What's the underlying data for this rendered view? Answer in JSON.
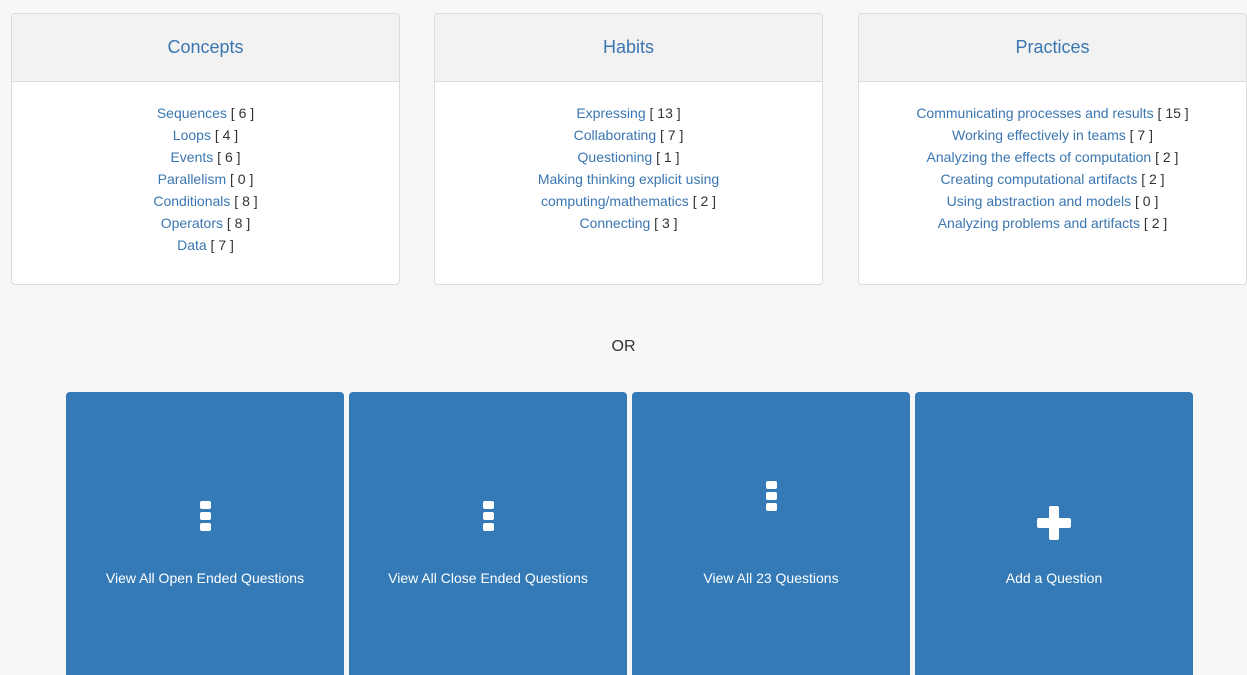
{
  "panels": [
    {
      "title": "Concepts",
      "items": [
        {
          "label": "Sequences",
          "count": "[ 6 ]"
        },
        {
          "label": "Loops",
          "count": "[ 4 ]"
        },
        {
          "label": "Events",
          "count": "[ 6 ]"
        },
        {
          "label": "Parallelism",
          "count": "[ 0 ]"
        },
        {
          "label": "Conditionals",
          "count": "[ 8 ]"
        },
        {
          "label": "Operators",
          "count": "[ 8 ]"
        },
        {
          "label": "Data",
          "count": "[ 7 ]"
        }
      ]
    },
    {
      "title": "Habits",
      "items": [
        {
          "label": "Expressing",
          "count": "[ 13 ]"
        },
        {
          "label": "Collaborating",
          "count": "[ 7 ]"
        },
        {
          "label": "Questioning",
          "count": "[ 1 ]"
        },
        {
          "label_line1": "Making thinking explicit using",
          "label": "computing/mathematics",
          "count": "[ 2 ]"
        },
        {
          "label": "Connecting",
          "count": "[ 3 ]"
        }
      ]
    },
    {
      "title": "Practices",
      "items": [
        {
          "label": "Communicating processes and results",
          "count": "[ 15 ]"
        },
        {
          "label": "Working effectively in teams",
          "count": "[ 7 ]"
        },
        {
          "label": "Analyzing the effects of computation",
          "count": "[ 2 ]"
        },
        {
          "label": "Creating computational artifacts",
          "count": "[ 2 ]"
        },
        {
          "label": "Using abstraction and models",
          "count": "[ 0 ]"
        },
        {
          "label": "Analyzing problems and artifacts",
          "count": "[ 2 ]"
        }
      ]
    }
  ],
  "separator": "OR",
  "tiles": [
    {
      "label": "View All Open Ended Questions",
      "icon": "ellipsis-vertical-icon"
    },
    {
      "label": "View All Close Ended Questions",
      "icon": "ellipsis-vertical-icon"
    },
    {
      "label": "View All 23 Questions",
      "icon": "ellipsis-vertical-icon"
    },
    {
      "label": "Add a Question",
      "icon": "plus-icon"
    }
  ],
  "colors": {
    "accent": "#337ab7",
    "link": "#3a76b1",
    "background": "#f7f7f7"
  }
}
